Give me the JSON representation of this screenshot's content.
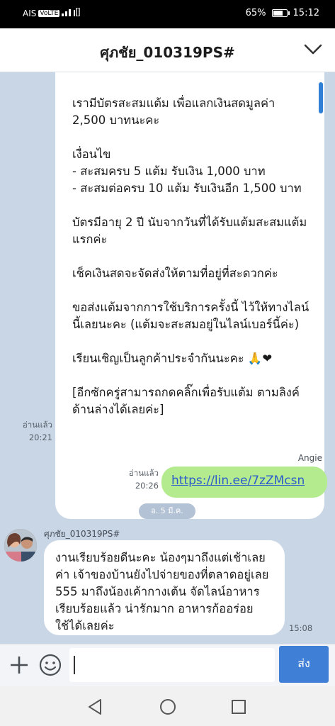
{
  "status": {
    "carrier": "AIS",
    "volte": "VoLTE",
    "battery_percent": "65%",
    "battery_level": 0.65,
    "time": "15:12"
  },
  "header": {
    "title": "ศุภชัย_010319PS#"
  },
  "messages": {
    "incoming_1": {
      "lines": [
        "เรามีบัตรสะสมแต้ม เพื่อแลกเงินสดมูลค่า 2,500 บาทนะคะ",
        "เงื่อนไข\n- สะสมครบ 5 แต้ม รับเงิน 1,000 บาท\n- สะสมต่อครบ 10 แต้ม รับเงินอีก 1,500 บาท",
        "บัตรมีอายุ 2 ปี นับจากวันที่ได้รับแต้มสะสมแต้มแรกค่ะ",
        "เช็คเงินสดจะจัดส่งให้ตามที่อยู่ที่สะดวกค่ะ",
        "ขอส่งแต้มจากการใช้บริการครั้งนี้ ไว้ให้ทางไลน์นี้เลยนะคะ (แต้มจะสะสมอยู่ในไลน์เบอร์นี้ค่ะ)",
        "เรียนเชิญเป็นลูกค้าประจำกันนะคะ 🙏❤",
        "[อีกซักครู่สามารถกดคลิ๊กเพื่อรับแต้ม ตามลิงค์ด้านล่างได้เลยค่ะ]"
      ],
      "read_label": "อ่านแล้ว",
      "time": "20:21"
    },
    "outgoing_1": {
      "sender": "Angie",
      "link": "https://lin.ee/7zZMcsn",
      "read_label": "อ่านแล้ว",
      "time": "20:26"
    },
    "date_divider": "อ. 5 มี.ค.",
    "incoming_2": {
      "sender": "ศุภชัย_010319PS#",
      "text": "งานเรียบร้อยดีนะคะ น้องๆมาถึงแต่เช้าเลยค่า เจ้าของบ้านยังไปจ่ายของที่ตลาดอยู่เลย 555 มาถึงน้องเค้ากางเต้น จัดไลน์อาหารเรียบร้อยแล้ว น่ารักมาก อาหารก้ออร่อยใช้ได้เลยค่ะ",
      "time": "15:08"
    }
  },
  "input": {
    "placeholder": "",
    "send_label": "ส่ง"
  }
}
